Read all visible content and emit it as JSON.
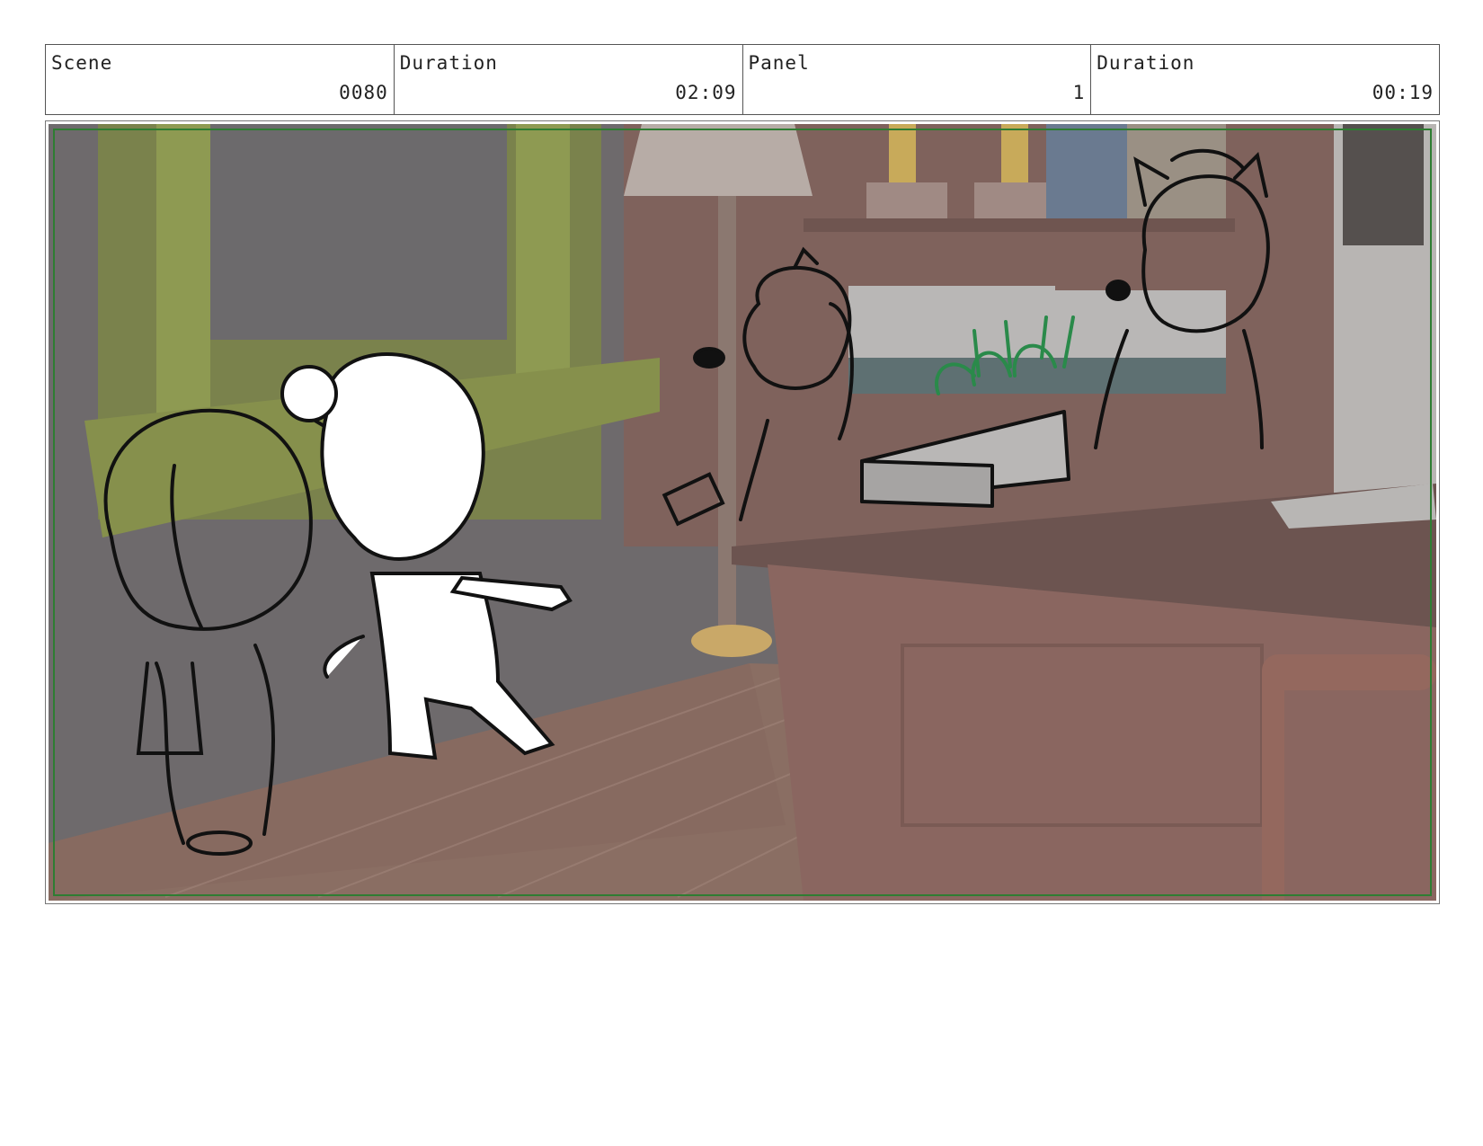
{
  "header": {
    "scene_label": "Scene",
    "scene_value": "0080",
    "scene_duration_label": "Duration",
    "scene_duration_value": "02:09",
    "panel_label": "Panel",
    "panel_value": "1",
    "panel_duration_label": "Duration",
    "panel_duration_value": "00:19"
  },
  "panel_image": {
    "description_icon": "storyboard-drawing",
    "colors": {
      "safe_area": "#2e7d32",
      "wall": "#6e6a6c",
      "floor": "#8a6e63",
      "desk": "#7a5a52",
      "window_frame": "#8a9a4e",
      "sketch_ink": "#111111",
      "money": "#2a8a4a"
    }
  }
}
